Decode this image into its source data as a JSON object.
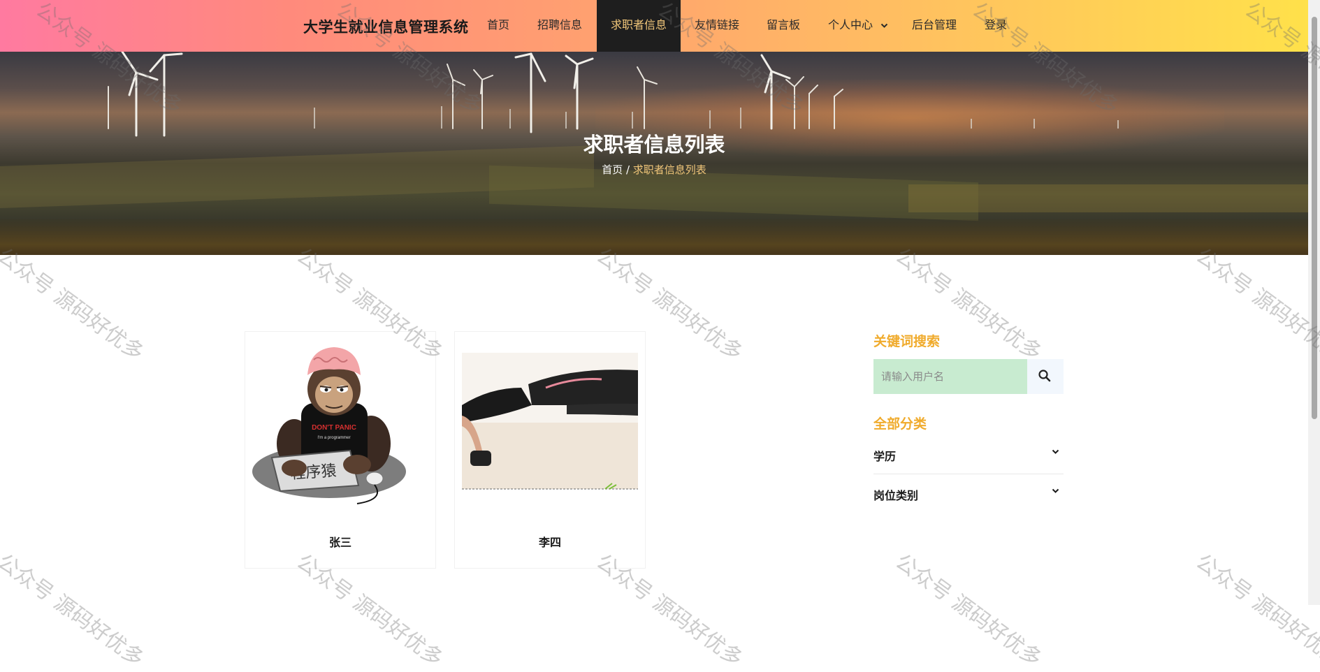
{
  "app": {
    "title": "大学生就业信息管理系统"
  },
  "nav": {
    "items": [
      {
        "label": "首页"
      },
      {
        "label": "招聘信息"
      },
      {
        "label": "求职者信息"
      },
      {
        "label": "友情链接"
      },
      {
        "label": "留言板"
      },
      {
        "label": "个人中心"
      },
      {
        "label": "后台管理"
      },
      {
        "label": "登录"
      }
    ],
    "active_index": 2
  },
  "banner": {
    "title": "求职者信息列表",
    "breadcrumb": {
      "home": "首页",
      "separator": " / ",
      "current": "求职者信息列表"
    }
  },
  "cards": [
    {
      "name": "张三",
      "image": "monkey-programmer-illustration",
      "image_text": "程序猿",
      "shirt_text": "DON'T PANIC",
      "shirt_sub": "I'm a programmer"
    },
    {
      "name": "李四",
      "image": "person-doing-pushups-photo"
    }
  ],
  "sidebar": {
    "search_title": "关键词搜索",
    "search_placeholder": "请输入用户名",
    "search_value": "",
    "category_title": "全部分类",
    "categories": [
      {
        "label": "学历"
      },
      {
        "label": "岗位类别"
      }
    ]
  },
  "watermark": {
    "text": "公众号 源码好优多"
  },
  "colors": {
    "accent": "#f0ab2c",
    "nav_active_bg": "#1e1e1e",
    "nav_active_text": "#f2c77a",
    "search_bg": "#c8ebd0",
    "gradient_start": "#ff7aa0",
    "gradient_end": "#ffe14a"
  }
}
